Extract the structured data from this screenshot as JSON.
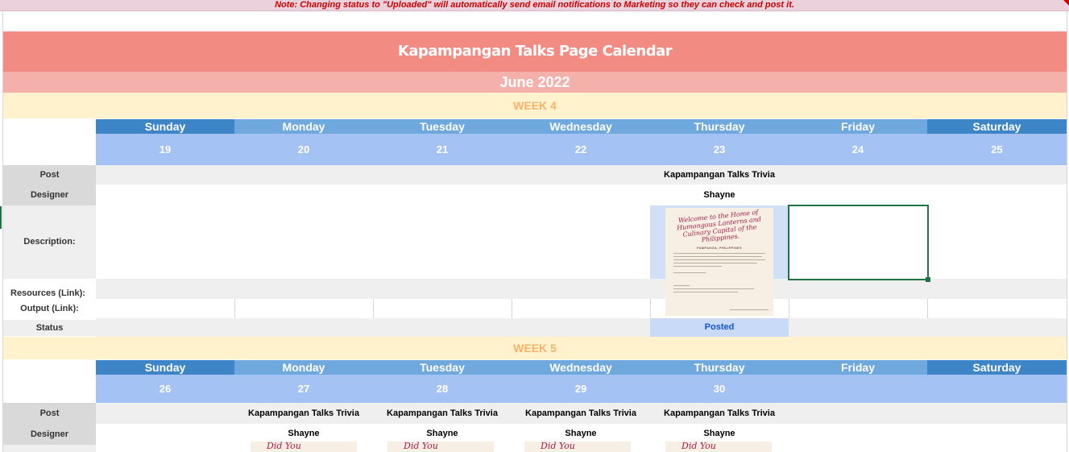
{
  "note": "Note: Changing status to \"Uploaded\" will automatically send email notifications to Marketing so they can check and post it.",
  "title": "Kapampangan Talks Page Calendar",
  "month": "June 2022",
  "days": [
    "Sunday",
    "Monday",
    "Tuesday",
    "Wednesday",
    "Thursday",
    "Friday",
    "Saturday"
  ],
  "row_labels": {
    "post": "Post",
    "designer": "Designer",
    "description": "Description:",
    "resources": "Resources (Link):",
    "output": "Output (Link):",
    "status": "Status"
  },
  "week4": {
    "label": "WEEK 4",
    "dates": [
      "19",
      "20",
      "21",
      "22",
      "23",
      "24",
      "25"
    ],
    "thursday": {
      "post": "Kapampangan Talks Trivia",
      "designer": "Shayne",
      "status": "Posted",
      "thumbnail": {
        "title": "Welcome to the Home of Humongous Lanterns and Culinary Capital of the Philippines.",
        "subtitle": "PAMPANGA, PHILIPPINES"
      }
    }
  },
  "week5": {
    "label": "WEEK 5",
    "dates": [
      "26",
      "27",
      "28",
      "29",
      "30",
      "",
      ""
    ],
    "posts": [
      "",
      "Kapampangan Talks Trivia",
      "Kapampangan Talks Trivia",
      "Kapampangan Talks Trivia",
      "Kapampangan Talks Trivia",
      "",
      ""
    ],
    "designers": [
      "",
      "Shayne",
      "Shayne",
      "Shayne",
      "Shayne",
      "",
      ""
    ],
    "thumb_text": "Did You"
  },
  "colors": {
    "title_bg": "#f28b82",
    "month_bg": "#f4b1ab",
    "week_bg": "#fff2cc",
    "day_header": "#6fa8dc",
    "day_header_dark": "#3d85c6",
    "date_row": "#a4c2f4",
    "posted_bg": "#c9daf8",
    "selection": "#217346"
  }
}
